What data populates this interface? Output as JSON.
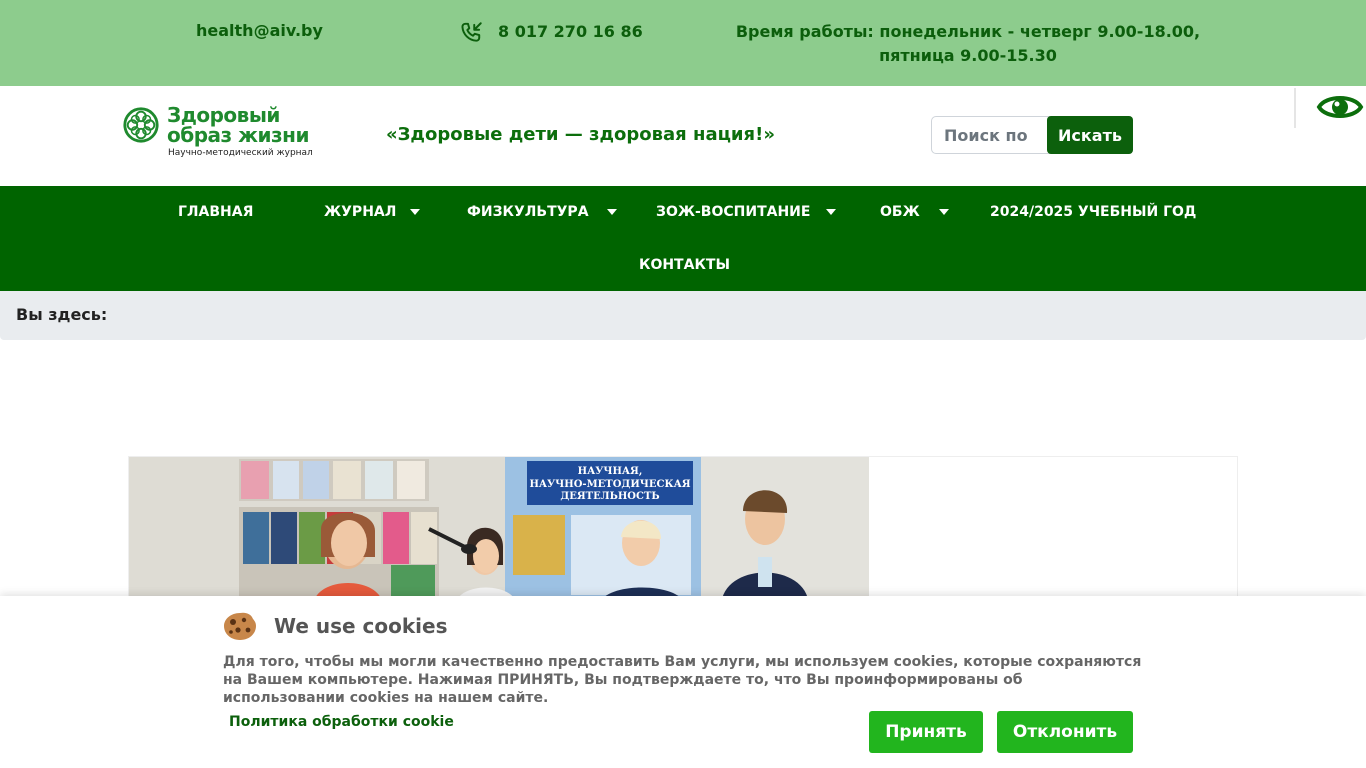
{
  "topbar": {
    "email": "health@aiv.by",
    "phone_icon": "phone-incoming-icon",
    "phone": "8 017 270 16 86",
    "hours": "Время работы: понедельник - четверг 9.00-18.00, пятница 9.00-15.30"
  },
  "header": {
    "logo_line1": "Здоровый",
    "logo_line2": "образ жизни",
    "logo_subtitle": "Научно-методический журнал",
    "slogan": "«Здоровые дети — здоровая нация!»",
    "search_placeholder": "Поиск по",
    "search_button": "Искать",
    "accessibility_icon": "eye-icon"
  },
  "nav": {
    "items": [
      {
        "label": "Главная",
        "has_dropdown": false
      },
      {
        "label": "Журнал",
        "has_dropdown": true
      },
      {
        "label": "Физкультура",
        "has_dropdown": true
      },
      {
        "label": "ЗОЖ-воспитание",
        "has_dropdown": true
      },
      {
        "label": "ОБЖ",
        "has_dropdown": true
      },
      {
        "label": "2024/2025 учебный год",
        "has_dropdown": false
      },
      {
        "label": "Контакты",
        "has_dropdown": false
      }
    ]
  },
  "breadcrumb": {
    "label": "Вы здесь:"
  },
  "photo": {
    "banner_line1": "НАУЧНАЯ,",
    "banner_line2": "НАУЧНО-МЕТОДИЧЕСКАЯ",
    "banner_line3": "ДЕЯТЕЛЬНОСТЬ"
  },
  "cookie": {
    "title": "We use cookies",
    "text": "Для того, чтобы мы могли качественно предоставить Вам услуги, мы используем cookies, которые сохраняются на Вашем компьютере. Нажимая ПРИНЯТЬ, Вы подтверждаете то, что Вы проинформированы об использовании cookies на нашем сайте.",
    "policy_link": "Политика обработки cookie",
    "accept": "Принять",
    "decline": "Отклонить"
  },
  "colors": {
    "topbar_bg": "#8dcc8d",
    "nav_bg": "#006400",
    "accent_green": "#0c600c",
    "cookie_button": "#22b51e",
    "breadcrumb_bg": "#e9ecef"
  }
}
